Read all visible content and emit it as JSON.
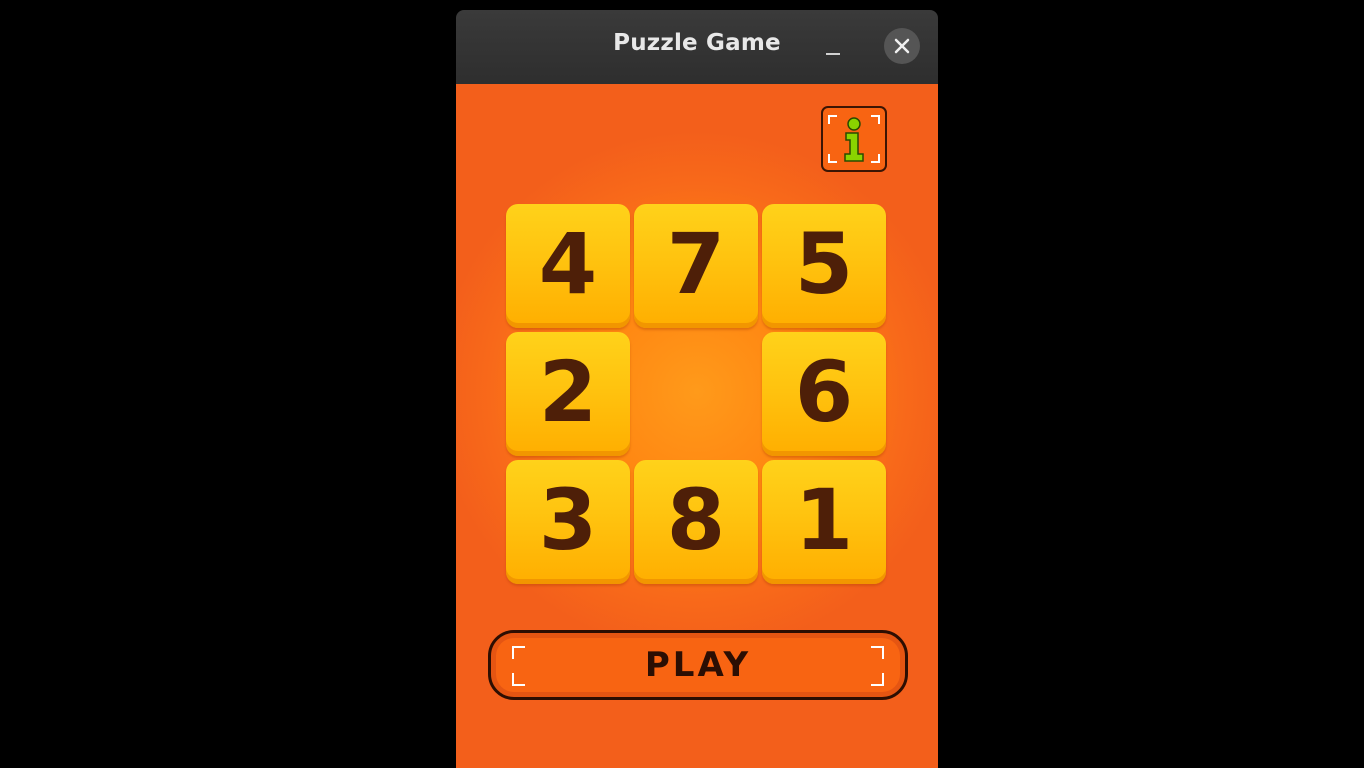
{
  "window": {
    "title": "Puzzle Game"
  },
  "game": {
    "info_label": "i",
    "play_label": "PLAY",
    "tiles": [
      {
        "row": 0,
        "col": 0,
        "value": "4"
      },
      {
        "row": 0,
        "col": 1,
        "value": "7"
      },
      {
        "row": 0,
        "col": 2,
        "value": "5"
      },
      {
        "row": 1,
        "col": 0,
        "value": "2"
      },
      {
        "row": 1,
        "col": 2,
        "value": "6"
      },
      {
        "row": 2,
        "col": 0,
        "value": "3"
      },
      {
        "row": 2,
        "col": 1,
        "value": "8"
      },
      {
        "row": 2,
        "col": 2,
        "value": "1"
      }
    ],
    "empty_cell": {
      "row": 1,
      "col": 1
    }
  },
  "colors": {
    "background": "#ff8411",
    "tile": "#ffc30f",
    "tile_text": "#4e1f08",
    "button": "#f86412",
    "info_icon": "#8ad400"
  },
  "icons": {
    "minimize": "minimize-icon",
    "close": "close-icon",
    "info": "info-icon"
  }
}
